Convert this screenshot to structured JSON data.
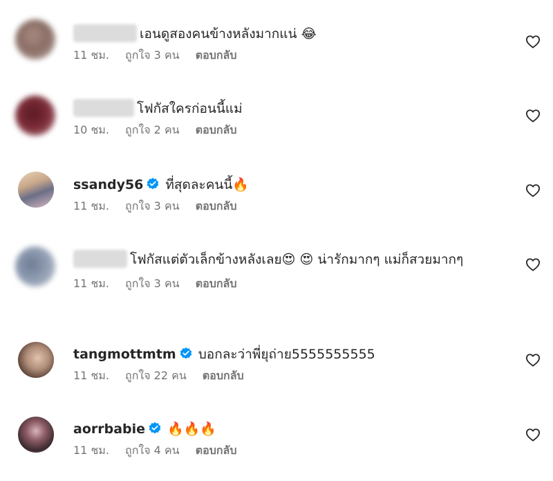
{
  "comments": [
    {
      "username": "",
      "username_blurred": true,
      "text": "เอนดูสองคนข้างหลังมากแน่ ",
      "emojis": [
        "😂"
      ],
      "time": "11 ชม.",
      "likes": "ถูกใจ 3 คน",
      "reply": "ตอบกลับ",
      "avatar_color": "#8a6e66",
      "verified": false
    },
    {
      "username": "",
      "username_blurred": true,
      "text": "โฟกัสใครก่อนนี้แม่",
      "emojis": [],
      "time": "10 ชม.",
      "likes": "ถูกใจ 2 คน",
      "reply": "ตอบกลับ",
      "avatar_color": "#7a2a35",
      "verified": false
    },
    {
      "username": "ssandy56",
      "username_blurred": false,
      "text": "ที่สุดละคนนี้",
      "emojis": [
        "🔥"
      ],
      "time": "11 ชม.",
      "likes": "ถูกใจ 3 คน",
      "reply": "ตอบกลับ",
      "avatar_color": "#c9a88a",
      "verified": true
    },
    {
      "username": "",
      "username_blurred": true,
      "text": "โฟกัสแต่ตัวเล็กข้างหลังเลย",
      "emojis": [
        "😍",
        "😍"
      ],
      "text_after": " น่ารักมากๆ แม่ก็สวยมากๆ",
      "time": "11 ชม.",
      "likes": "ถูกใจ 3 คน",
      "reply": "ตอบกลับ",
      "avatar_color": "#8e9bb0",
      "verified": false
    },
    {
      "username": "tangmottmtm",
      "username_blurred": false,
      "text": "บอกละว่าพี่ยุถ่าย5555555555",
      "emojis": [],
      "time": "11 ชม.",
      "likes": "ถูกใจ 22 คน",
      "reply": "ตอบกลับ",
      "avatar_color": "#b08e7a",
      "verified": true
    },
    {
      "username": "aorrbabie",
      "username_blurred": false,
      "text": "",
      "emojis": [
        "🔥",
        "🔥",
        "🔥"
      ],
      "time": "11 ชม.",
      "likes": "ถูกใจ 4 คน",
      "reply": "ตอบกลับ",
      "avatar_color": "#5a3a3e",
      "verified": true
    }
  ],
  "colors": {
    "verified": "#0095f6",
    "meta": "#737373",
    "text": "#262626"
  },
  "icons": {
    "like": "heart-outline-icon",
    "verified": "verified-badge-icon"
  }
}
